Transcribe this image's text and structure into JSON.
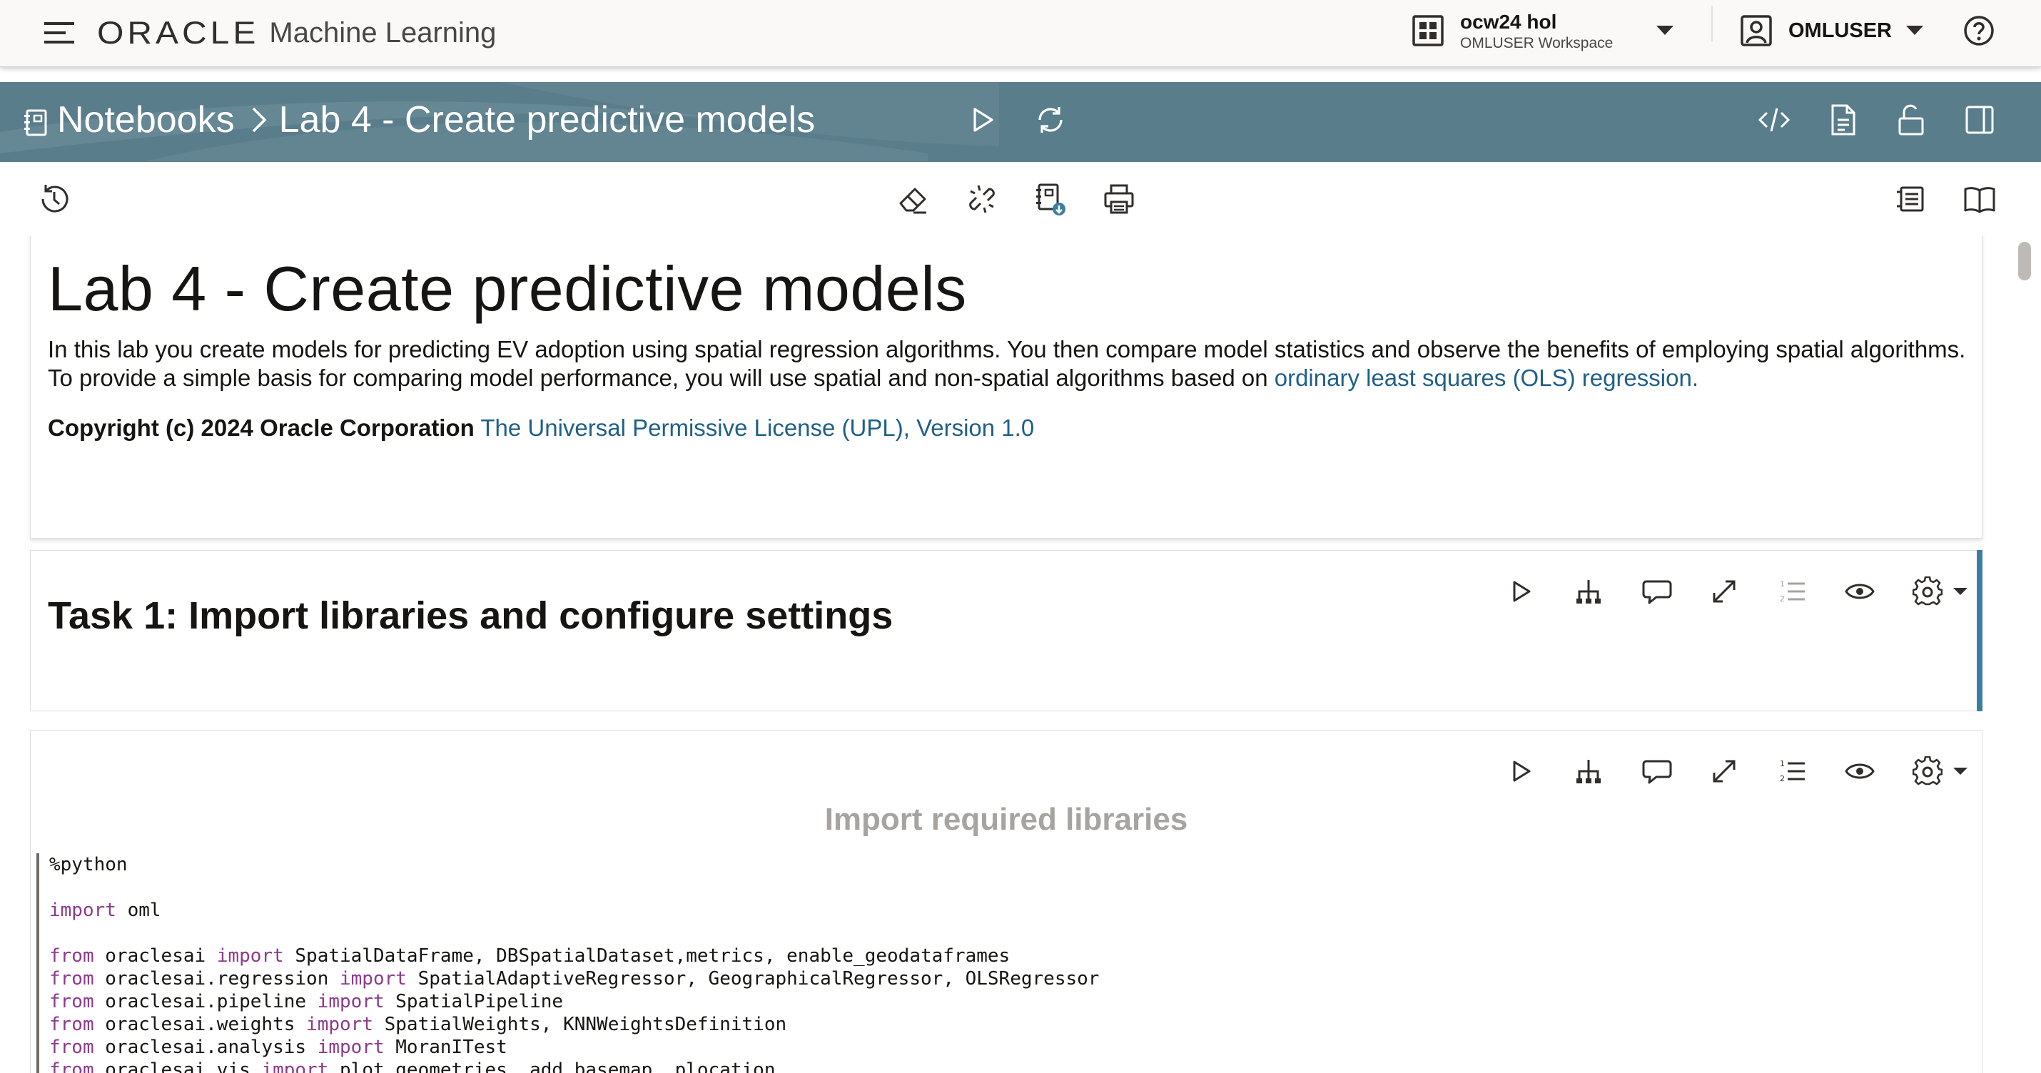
{
  "app": {
    "brand_oracle": "ORACLE",
    "brand_product": "Machine Learning",
    "workspace_name": "ocw24 hol",
    "workspace_sub": "OMLUSER Workspace",
    "user_name": "OMLUSER"
  },
  "breadcrumb": {
    "root": "Notebooks",
    "current": "Lab 4 - Create predictive models"
  },
  "icons": {
    "header": [
      "hamburger-menu-icon",
      "workspace-grid-icon",
      "user-icon",
      "help-icon"
    ],
    "banner": [
      "run-all-icon",
      "refresh-icon",
      "code-icon",
      "document-icon",
      "unlock-icon",
      "panel-icon"
    ],
    "toolbar": [
      "history-icon",
      "eraser-icon",
      "unlink-icon",
      "export-notebook-icon",
      "print-icon",
      "list-icon",
      "book-icon"
    ],
    "paragraph_tools": [
      "run-icon",
      "hierarchy-icon",
      "comment-icon",
      "expand-icon",
      "line-numbers-icon",
      "eye-icon",
      "gear-icon"
    ]
  },
  "colors": {
    "banner": "#5a7d8b",
    "link": "#1f5f8a",
    "active_paragraph": "#3a7ea1",
    "code_keyword": "#8c3a8c"
  },
  "paragraphs": {
    "intro": {
      "heading": "Lab 4 - Create predictive models",
      "text_1": "In this lab you create models for predicting EV adoption using spatial regression algorithms. You then compare model statistics and observe the benefits of employing spatial algorithms. To provide a simple basis for comparing model performance, you will use spatial and non-spatial algorithms based on ",
      "link_1": "ordinary least squares (OLS) regression.",
      "copyright": "Copyright (c) 2024 Oracle Corporation",
      "link_2": "The Universal Permissive License (UPL), Version 1.0"
    },
    "task1": {
      "heading": "Task 1: Import libraries and configure settings"
    },
    "code1": {
      "title": "Import required libraries",
      "lines": {
        "l1": "%python",
        "l2_kw": "import",
        "l2_rest": " oml",
        "l3_from": "from",
        "l3_mod": " oraclesai ",
        "l3_imp": "import",
        "l3_rest": " SpatialDataFrame, DBSpatialDataset,metrics, enable_geodataframes",
        "l4_from": "from",
        "l4_mod": " oraclesai.regression ",
        "l4_imp": "import",
        "l4_rest": " SpatialAdaptiveRegressor, GeographicalRegressor, OLSRegressor",
        "l5_from": "from",
        "l5_mod": " oraclesai.pipeline ",
        "l5_imp": "import",
        "l5_rest": " SpatialPipeline",
        "l6_from": "from",
        "l6_mod": " oraclesai.weights ",
        "l6_imp": "import",
        "l6_rest": " SpatialWeights, KNNWeightsDefinition",
        "l7_from": "from",
        "l7_mod": " oraclesai.analysis ",
        "l7_imp": "import",
        "l7_rest": " MoranITest",
        "l8_from": "from",
        "l8_mod": " oraclesai.vis ",
        "l8_imp": "import",
        "l8_rest": " plot_geometries, add_basemap, plocation"
      }
    }
  }
}
